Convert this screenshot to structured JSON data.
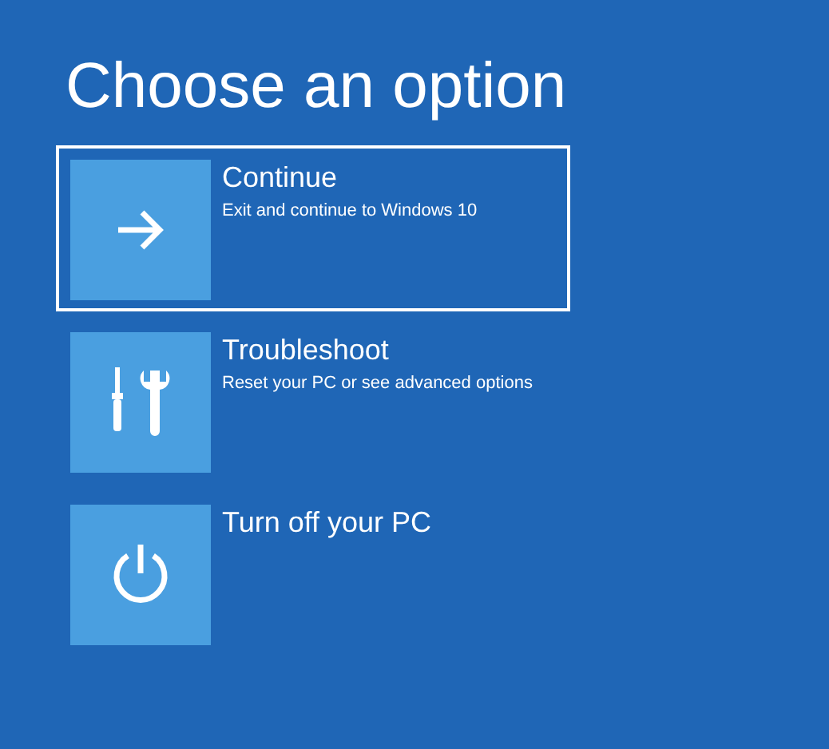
{
  "title": "Choose an option",
  "options": [
    {
      "kind": "continue",
      "label": "Continue",
      "description": "Exit and continue to Windows 10",
      "selected": true
    },
    {
      "kind": "troubleshoot",
      "label": "Troubleshoot",
      "description": "Reset your PC or see advanced options",
      "selected": false
    },
    {
      "kind": "power",
      "label": "Turn off your PC",
      "selected": false
    }
  ]
}
